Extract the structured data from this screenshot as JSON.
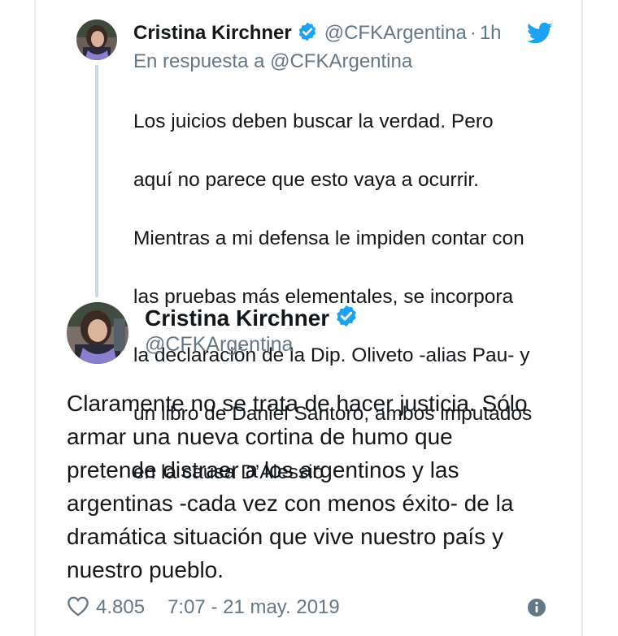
{
  "parent_tweet": {
    "author_name": "Cristina Kirchner",
    "handle": "@CFKArgentina",
    "separator": "·",
    "time": "1h",
    "reply_to": "En respuesta a @CFKArgentina",
    "text_lines": [
      "Los juicios deben buscar la verdad. Pero",
      "aquí no parece que esto vaya a ocurrir.",
      "Mientras a mi defensa le impiden contar con",
      "las pruebas más elementales, se incorpora",
      "la declaración de la Dip. Oliveto -alias Pau- y",
      "un libro de Daniel Santoro, ambos imputados",
      "en la causa D’Alessio"
    ]
  },
  "main_tweet": {
    "author_name": "Cristina Kirchner",
    "handle": "@CFKArgentina",
    "text_lines": [
      "Claramente no se trata de hacer justicia. Sólo",
      "armar una nueva cortina de humo que",
      "pretende distraer a los argentinos y las",
      "argentinas -cada vez con menos éxito- de la",
      "dramática situación que vive nuestro país y",
      "nuestro pueblo."
    ],
    "likes": "4.805",
    "timestamp": "7:07 - 21 may. 2019"
  },
  "icons": {
    "verified": "verified-badge-icon",
    "twitter": "twitter-bird-icon",
    "like": "heart-icon",
    "info": "info-icon"
  },
  "colors": {
    "brand_blue": "#1da1f2",
    "text_primary": "#14171a",
    "text_secondary": "#657786"
  }
}
